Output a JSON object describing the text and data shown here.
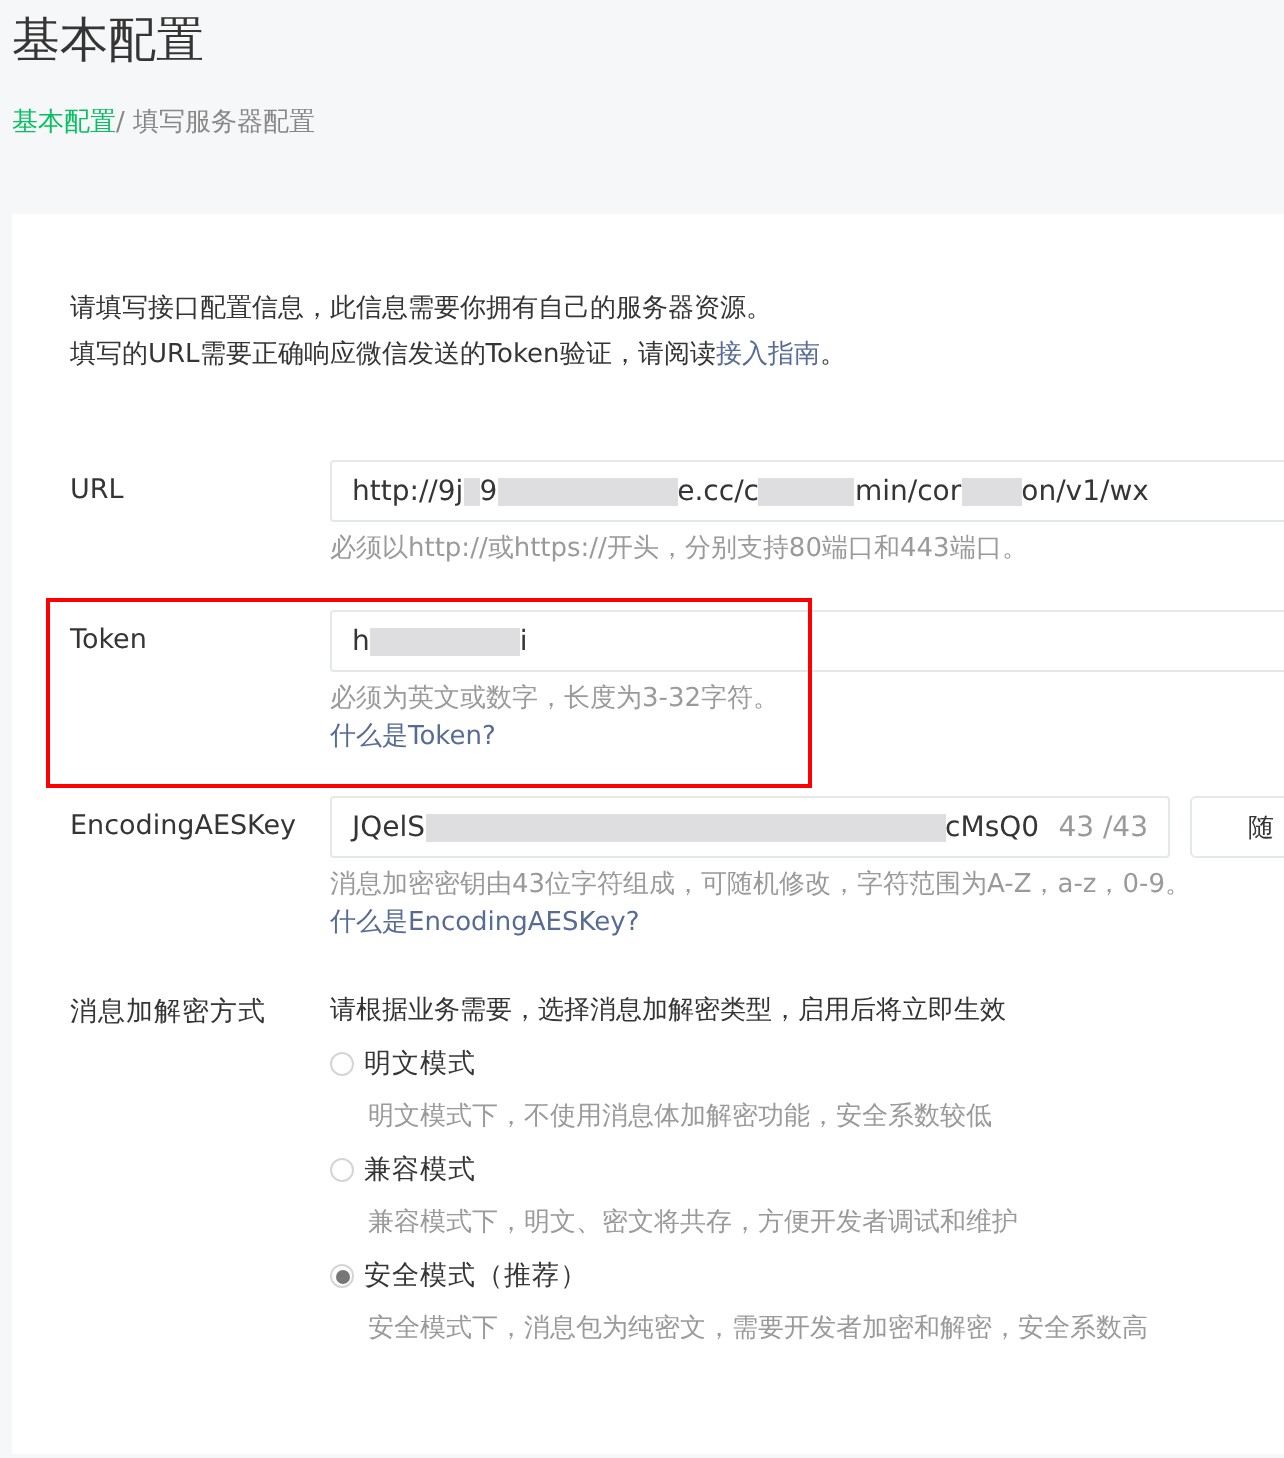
{
  "page_title": "基本配置",
  "breadcrumb": {
    "link": "基本配置",
    "current": "/ 填写服务器配置"
  },
  "intro": [
    "请填写接口配置信息，此信息需要你拥有自己的服务器资源。",
    "填写的URL需要正确响应微信发送的Token验证，请阅读"
  ],
  "intro_link": "接入指南",
  "intro_end": "。",
  "fields": [
    {
      "label": "URL",
      "kind": "text",
      "value_parts": [
        "http://9j",
        "9",
        "e.cc/c",
        "min/cor",
        "on/v1/wx"
      ],
      "hint": "必须以http://或https://开头，分别支持80端口和443端口。",
      "highlighted": false
    },
    {
      "label": "Token",
      "kind": "text",
      "value_parts": [
        "h",
        "i"
      ],
      "hint": "必须为英文或数字，长度为3-32字符。",
      "help_link": "什么是Token?",
      "highlighted": true
    },
    {
      "label": "EncodingAESKey",
      "kind": "key",
      "value_parts": [
        "JQelS",
        "cMsQ0"
      ],
      "counter": "43 /43",
      "button": "随",
      "hint": "消息加密密钥由43位字符组成，可随机修改，字符范围为A-Z，a-z，0-9。",
      "help_link": "什么是EncodingAESKey?",
      "highlighted": false
    }
  ],
  "encryption": {
    "label": "消息加解密方式",
    "description": "请根据业务需要，选择消息加解密类型，启用后将立即生效",
    "options": [
      {
        "label": "明文模式",
        "hint": "明文模式下，不使用消息体加解密功能，安全系数较低",
        "selected": false
      },
      {
        "label": "兼容模式",
        "hint": "兼容模式下，明文、密文将共存，方便开发者调试和维护",
        "selected": false
      },
      {
        "label": "安全模式（推荐）",
        "hint": "安全模式下，消息包为纯密文，需要开发者加密和解密，安全系数高",
        "selected": true
      }
    ]
  }
}
